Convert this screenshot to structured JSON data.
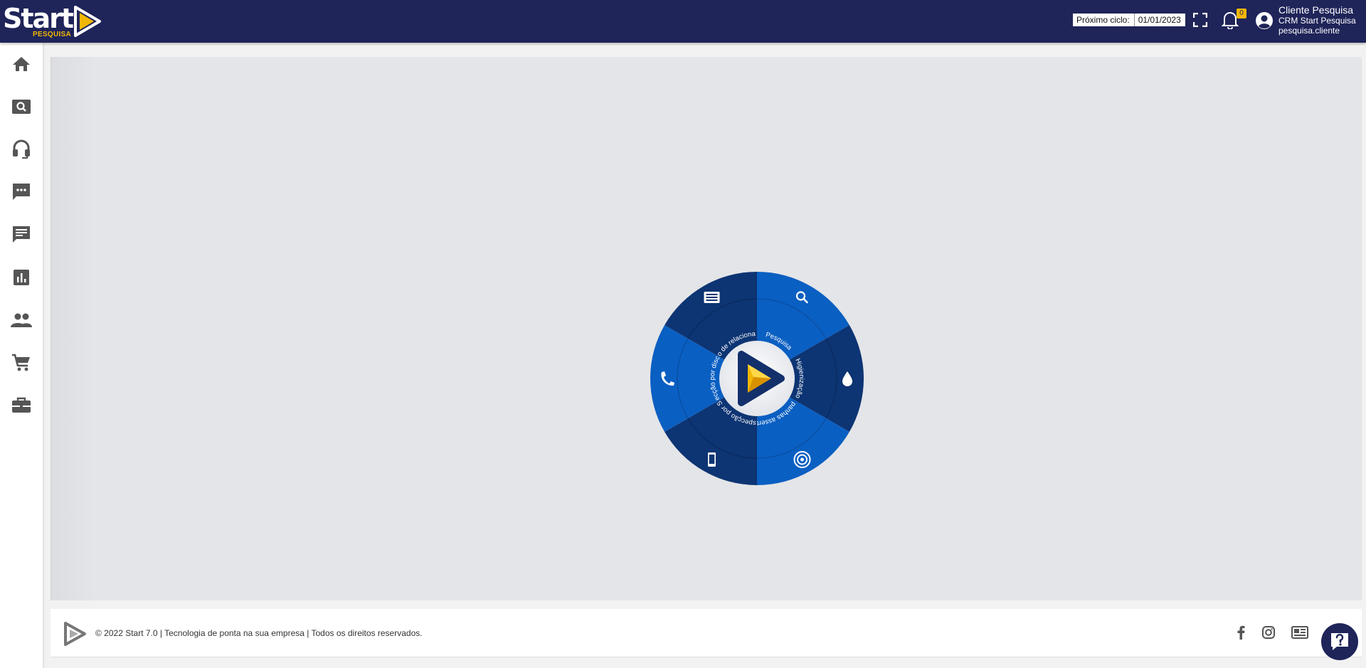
{
  "brand": {
    "name": "Start",
    "sub": "PESQUISA"
  },
  "header": {
    "cycle_label": "Próximo ciclo:",
    "cycle_value": "01/01/2023",
    "notifications_count": "0",
    "user_name": "Cliente Pesquisa",
    "user_company": "CRM Start Pesquisa",
    "user_login": "pesquisa.cliente"
  },
  "sidebar": {
    "items": [
      {
        "name": "home",
        "icon": "home-icon"
      },
      {
        "name": "search",
        "icon": "search-icon"
      },
      {
        "name": "support",
        "icon": "headset-icon"
      },
      {
        "name": "chat",
        "icon": "chat-dots-icon"
      },
      {
        "name": "messages",
        "icon": "message-icon"
      },
      {
        "name": "reports",
        "icon": "bar-chart-icon"
      },
      {
        "name": "contacts",
        "icon": "people-icon"
      },
      {
        "name": "shop",
        "icon": "cart-icon"
      },
      {
        "name": "business",
        "icon": "briefcase-icon"
      }
    ]
  },
  "wheel": {
    "segments": [
      {
        "label": "Pesquisa",
        "icon": "search-icon",
        "color": "#0a5fc2"
      },
      {
        "label": "Higienização",
        "icon": "drop-icon",
        "color": "#0d3473"
      },
      {
        "label": "Campanhas assertivas",
        "icon": "target-icon",
        "color": "#0a5fc2"
      },
      {
        "label": "Prospecção por SMS",
        "icon": "smartphone-icon",
        "color": "#0d3473"
      },
      {
        "label": "Prospecção por discadora",
        "icon": "phone-icon",
        "color": "#0a5fc2"
      },
      {
        "label": "Gestão de relacionamento",
        "icon": "list-icon",
        "color": "#0d3473"
      }
    ]
  },
  "footer": {
    "text": "© 2022 Start 7.0 | Tecnologia de ponta na sua empresa | Todos os direitos reservados."
  },
  "colors": {
    "topbar": "#1f2459",
    "accent": "#f2b705",
    "sidebar_icon": "#555555"
  }
}
